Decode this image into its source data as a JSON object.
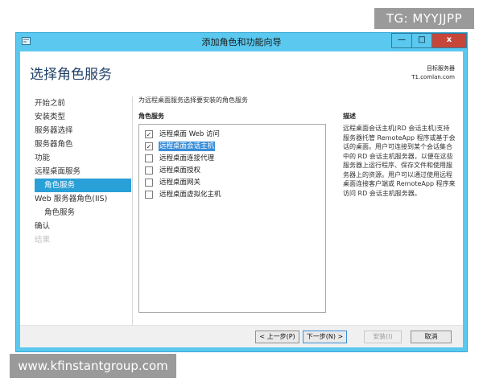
{
  "watermarks": {
    "top": "TG: MYYJJPP",
    "bottom": "www.kfinstantgroup.com"
  },
  "window": {
    "title": "添加角色和功能向导",
    "controls": {
      "minimize": "—",
      "maximize": "□",
      "close": "x"
    }
  },
  "header": {
    "page_title": "选择角色服务",
    "server_label": "目标服务器",
    "server_name": "T1.comlan.com"
  },
  "nav": {
    "items": [
      {
        "label": "开始之前"
      },
      {
        "label": "安装类型"
      },
      {
        "label": "服务器选择"
      },
      {
        "label": "服务器角色"
      },
      {
        "label": "功能"
      },
      {
        "label": "远程桌面服务"
      },
      {
        "label": "角色服务"
      },
      {
        "label": "Web 服务器角色(IIS)"
      },
      {
        "label": "角色服务"
      },
      {
        "label": "确认"
      },
      {
        "label": "结果"
      }
    ]
  },
  "main": {
    "instruction": "为远程桌面服务选择要安装的角色服务",
    "roles_heading": "角色服务",
    "roles": [
      {
        "label": "远程桌面 Web 访问",
        "checked": true
      },
      {
        "label": "远程桌面会话主机",
        "checked": true
      },
      {
        "label": "远程桌面连接代理",
        "checked": false
      },
      {
        "label": "远程桌面授权",
        "checked": false
      },
      {
        "label": "远程桌面网关",
        "checked": false
      },
      {
        "label": "远程桌面虚拟化主机",
        "checked": false
      }
    ],
    "check_mark": "✓"
  },
  "description": {
    "heading": "描述",
    "text": "远程桌面会话主机(RD 会话主机)支持服务器托管 RemoteApp 程序或基于会话的桌面。用户可连接到某个会话集合中的 RD 会话主机服务器，以便在这些服务器上运行程序、保存文件和使用服务器上的资源。用户可以通过使用远程桌面连接客户端或 RemoteApp 程序来访问 RD 会话主机服务器。"
  },
  "footer": {
    "prev": "< 上一步(P)",
    "next": "下一步(N) >",
    "install": "安装(I)",
    "cancel": "取消"
  },
  "colors": {
    "window_frame": "#5ac8ef",
    "nav_active": "#2aa0d8",
    "heading": "#1e3f66",
    "close_button": "#c7463a"
  }
}
